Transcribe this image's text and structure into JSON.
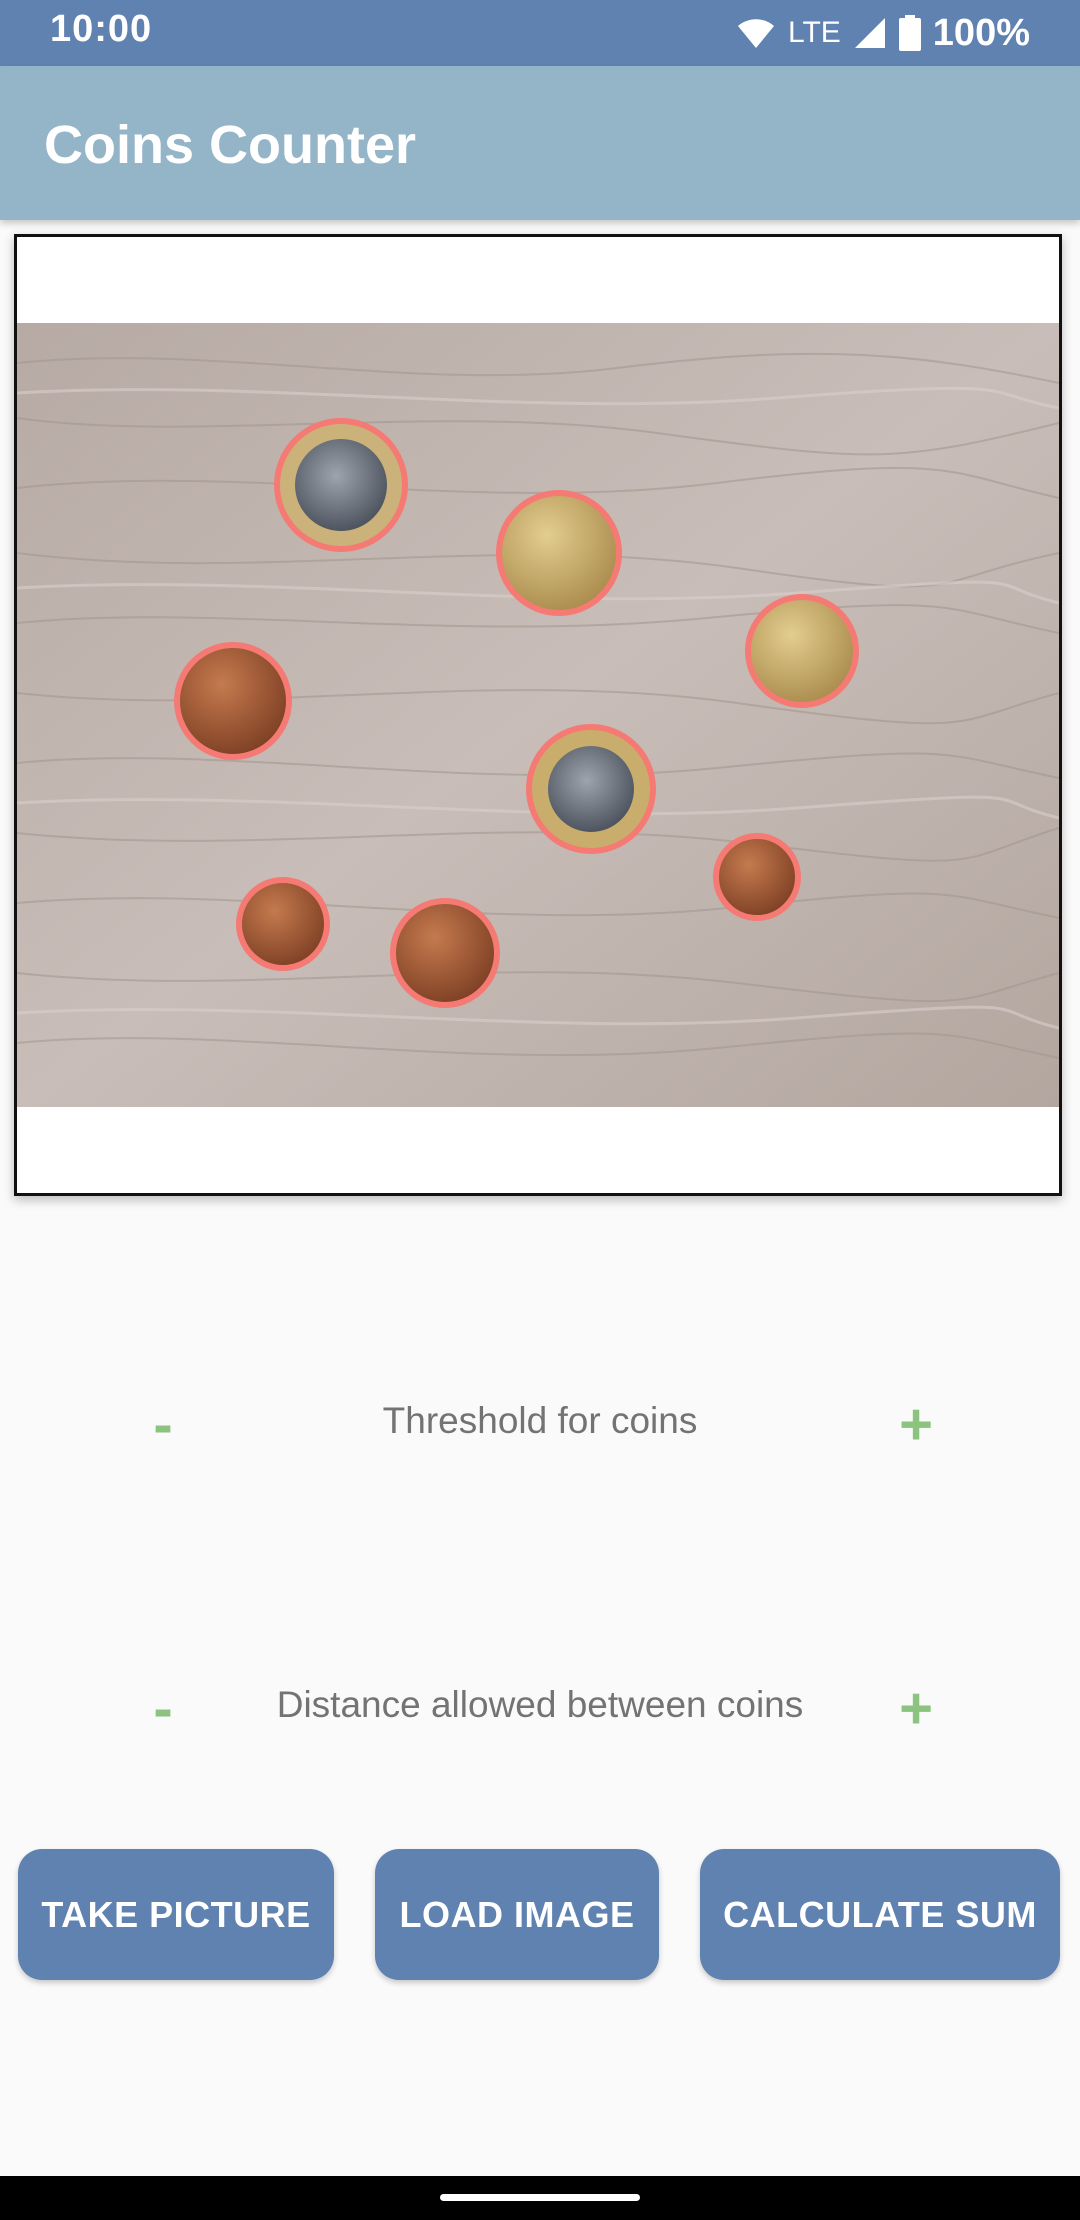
{
  "status_bar": {
    "time": "10:00",
    "network": "LTE",
    "battery": "100%"
  },
  "app_bar": {
    "title": "Coins Counter"
  },
  "preview": {
    "image_description": "photo of euro coins on a wooden table with detected circles highlighted",
    "highlight_color": "#f57a74"
  },
  "controls": {
    "threshold": {
      "minus": "-",
      "label": "Threshold for coins",
      "plus": "+"
    },
    "distance": {
      "minus": "-",
      "label": "Distance allowed between coins",
      "plus": "+"
    }
  },
  "actions": {
    "take_picture": "TAKE PICTURE",
    "load_image": "LOAD IMAGE",
    "calculate_sum": "CALCULATE SUM"
  },
  "colors": {
    "primary": "#5f82b1",
    "app_bar": "#94b4c8",
    "accent_green": "#8cc37e"
  }
}
